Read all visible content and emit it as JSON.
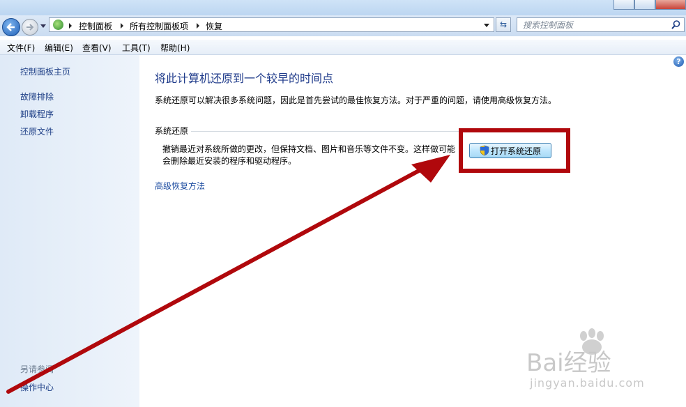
{
  "nav": {
    "breadcrumbs": [
      "控制面板",
      "所有控制面板项",
      "恢复"
    ],
    "search_placeholder": "搜索控制面板"
  },
  "menu": [
    "文件(F)",
    "编辑(E)",
    "查看(V)",
    "工具(T)",
    "帮助(H)"
  ],
  "sidebar": {
    "items": [
      "控制面板主页",
      "故障排除",
      "卸载程序",
      "还原文件"
    ],
    "see_also_title": "另请参阅",
    "see_also_items": [
      "操作中心"
    ]
  },
  "main": {
    "title": "将此计算机还原到一个较早的时间点",
    "intro": "系统还原可以解决很多系统问题，因此是首先尝试的最佳恢复方法。对于严重的问题，请使用高级恢复方法。",
    "section_title": "系统还原",
    "section_desc": "撤销最近对系统所做的更改，但保持文档、图片和音乐等文件不变。这样做可能会删除最近安装的程序和驱动程序。",
    "open_button": "打开系统还原",
    "advanced_link": "高级恢复方法"
  },
  "watermark": {
    "brand": "Bai经验",
    "url": "jingyan.baidu.com"
  },
  "colors": {
    "annotation": "#b0080c",
    "link": "#1e3f86"
  }
}
